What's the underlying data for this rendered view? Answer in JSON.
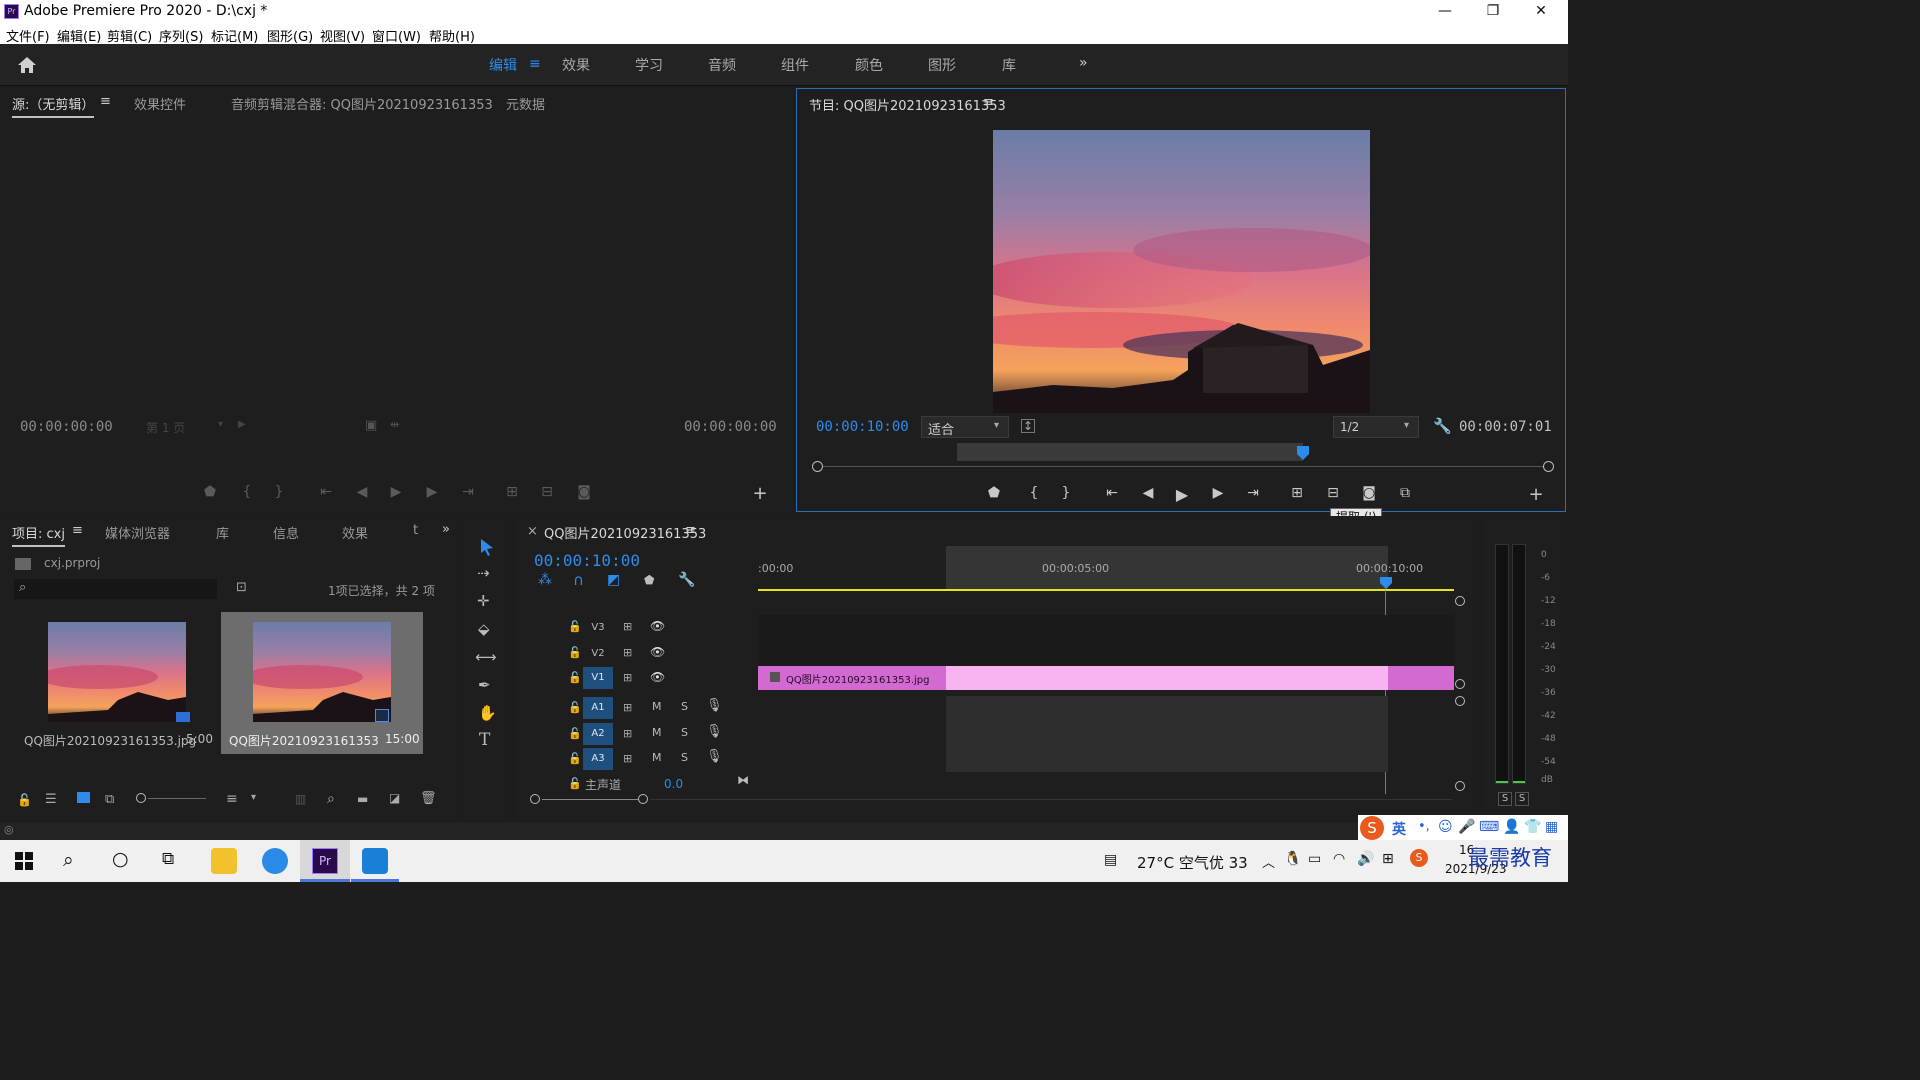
{
  "window": {
    "title": "Adobe Premiere Pro 2020 - D:\\cxj *",
    "app_icon": "Pr",
    "controls": [
      "minimize-icon",
      "maximize-icon",
      "close-icon"
    ]
  },
  "menu": [
    "文件(F)",
    "编辑(E)",
    "剪辑(C)",
    "序列(S)",
    "标记(M)",
    "图形(G)",
    "视图(V)",
    "窗口(W)",
    "帮助(H)"
  ],
  "workspaces": {
    "items": [
      "编辑",
      "效果",
      "学习",
      "音频",
      "组件",
      "颜色",
      "图形",
      "库"
    ],
    "active": "编辑",
    "more": "»"
  },
  "source_panel": {
    "tabs": [
      "源:（无剪辑）",
      "效果控件",
      "音频剪辑混合器: QQ图片20210923161353",
      "元数据"
    ],
    "timecode_in": "00:00:00:00",
    "timecode_out": "00:00:00:00",
    "page_select": "第 1 页"
  },
  "program_panel": {
    "tab": "节目: QQ图片20210923161353",
    "timecode": "00:00:10:00",
    "fit": "适合",
    "resolution": "1/2",
    "duration": "00:00:07:01",
    "tooltip": "提取 (')"
  },
  "project_panel": {
    "tabs": [
      "项目: cxj",
      "媒体浏览器",
      "库",
      "信息",
      "效果",
      "t"
    ],
    "project_file": "cxj.prproj",
    "selection_info": "1项已选择，共 2 项",
    "search_placeholder": "",
    "items": [
      {
        "name": "QQ图片20210923161353.jpg",
        "duration": "5:00"
      },
      {
        "name": "QQ图片20210923161353",
        "duration": "15:00"
      }
    ]
  },
  "timeline": {
    "tab": "QQ图片20210923161353",
    "timecode": "00:00:10:00",
    "ruler": [
      ":00:00",
      "00:00:05:00",
      "00:00:10:00"
    ],
    "tracks_video": [
      "V3",
      "V2",
      "V1"
    ],
    "tracks_audio": [
      "A1",
      "A2",
      "A3"
    ],
    "mix_label": "主声道",
    "mix_value": "0.0",
    "clip_name": "QQ图片20210923161353.jpg",
    "mute_label": "M",
    "solo_label": "S"
  },
  "audio_meter": {
    "scale": [
      "0",
      "-6",
      "-12",
      "-18",
      "-24",
      "-30",
      "-36",
      "-42",
      "-48",
      "-54",
      "dB"
    ],
    "solo_buttons": [
      "S",
      "S"
    ]
  },
  "taskbar": {
    "weather": "27°C 空气优 33",
    "ime": "英",
    "date": "2021/9/23",
    "time": "16:",
    "watermark": "最需教育"
  },
  "colors": {
    "accent_blue": "#2d8ceb",
    "clip_pink": "#f7b4f0",
    "clip_dark": "#d36ad2",
    "workarea_yellow": "#e5e51a"
  }
}
